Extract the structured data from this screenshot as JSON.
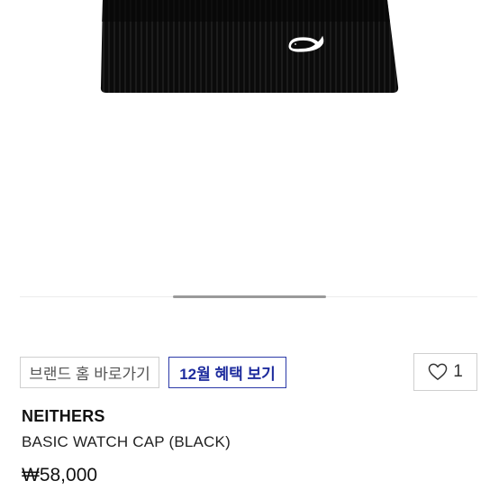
{
  "actions": {
    "brand_home_label": "브랜드 홈 바로가기",
    "december_benefit_label": "12월 혜택 보기"
  },
  "like": {
    "icon": "heart-icon",
    "count": "1"
  },
  "product": {
    "brand": "NEITHERS",
    "name": "BASIC WATCH CAP (BLACK)",
    "price": "₩58,000",
    "image": "black-ribbed-beanie-with-whale-patch"
  },
  "colors": {
    "accent": "#1f2d9e",
    "border": "#cfcfcf",
    "beanie": "#0b0b0b"
  }
}
